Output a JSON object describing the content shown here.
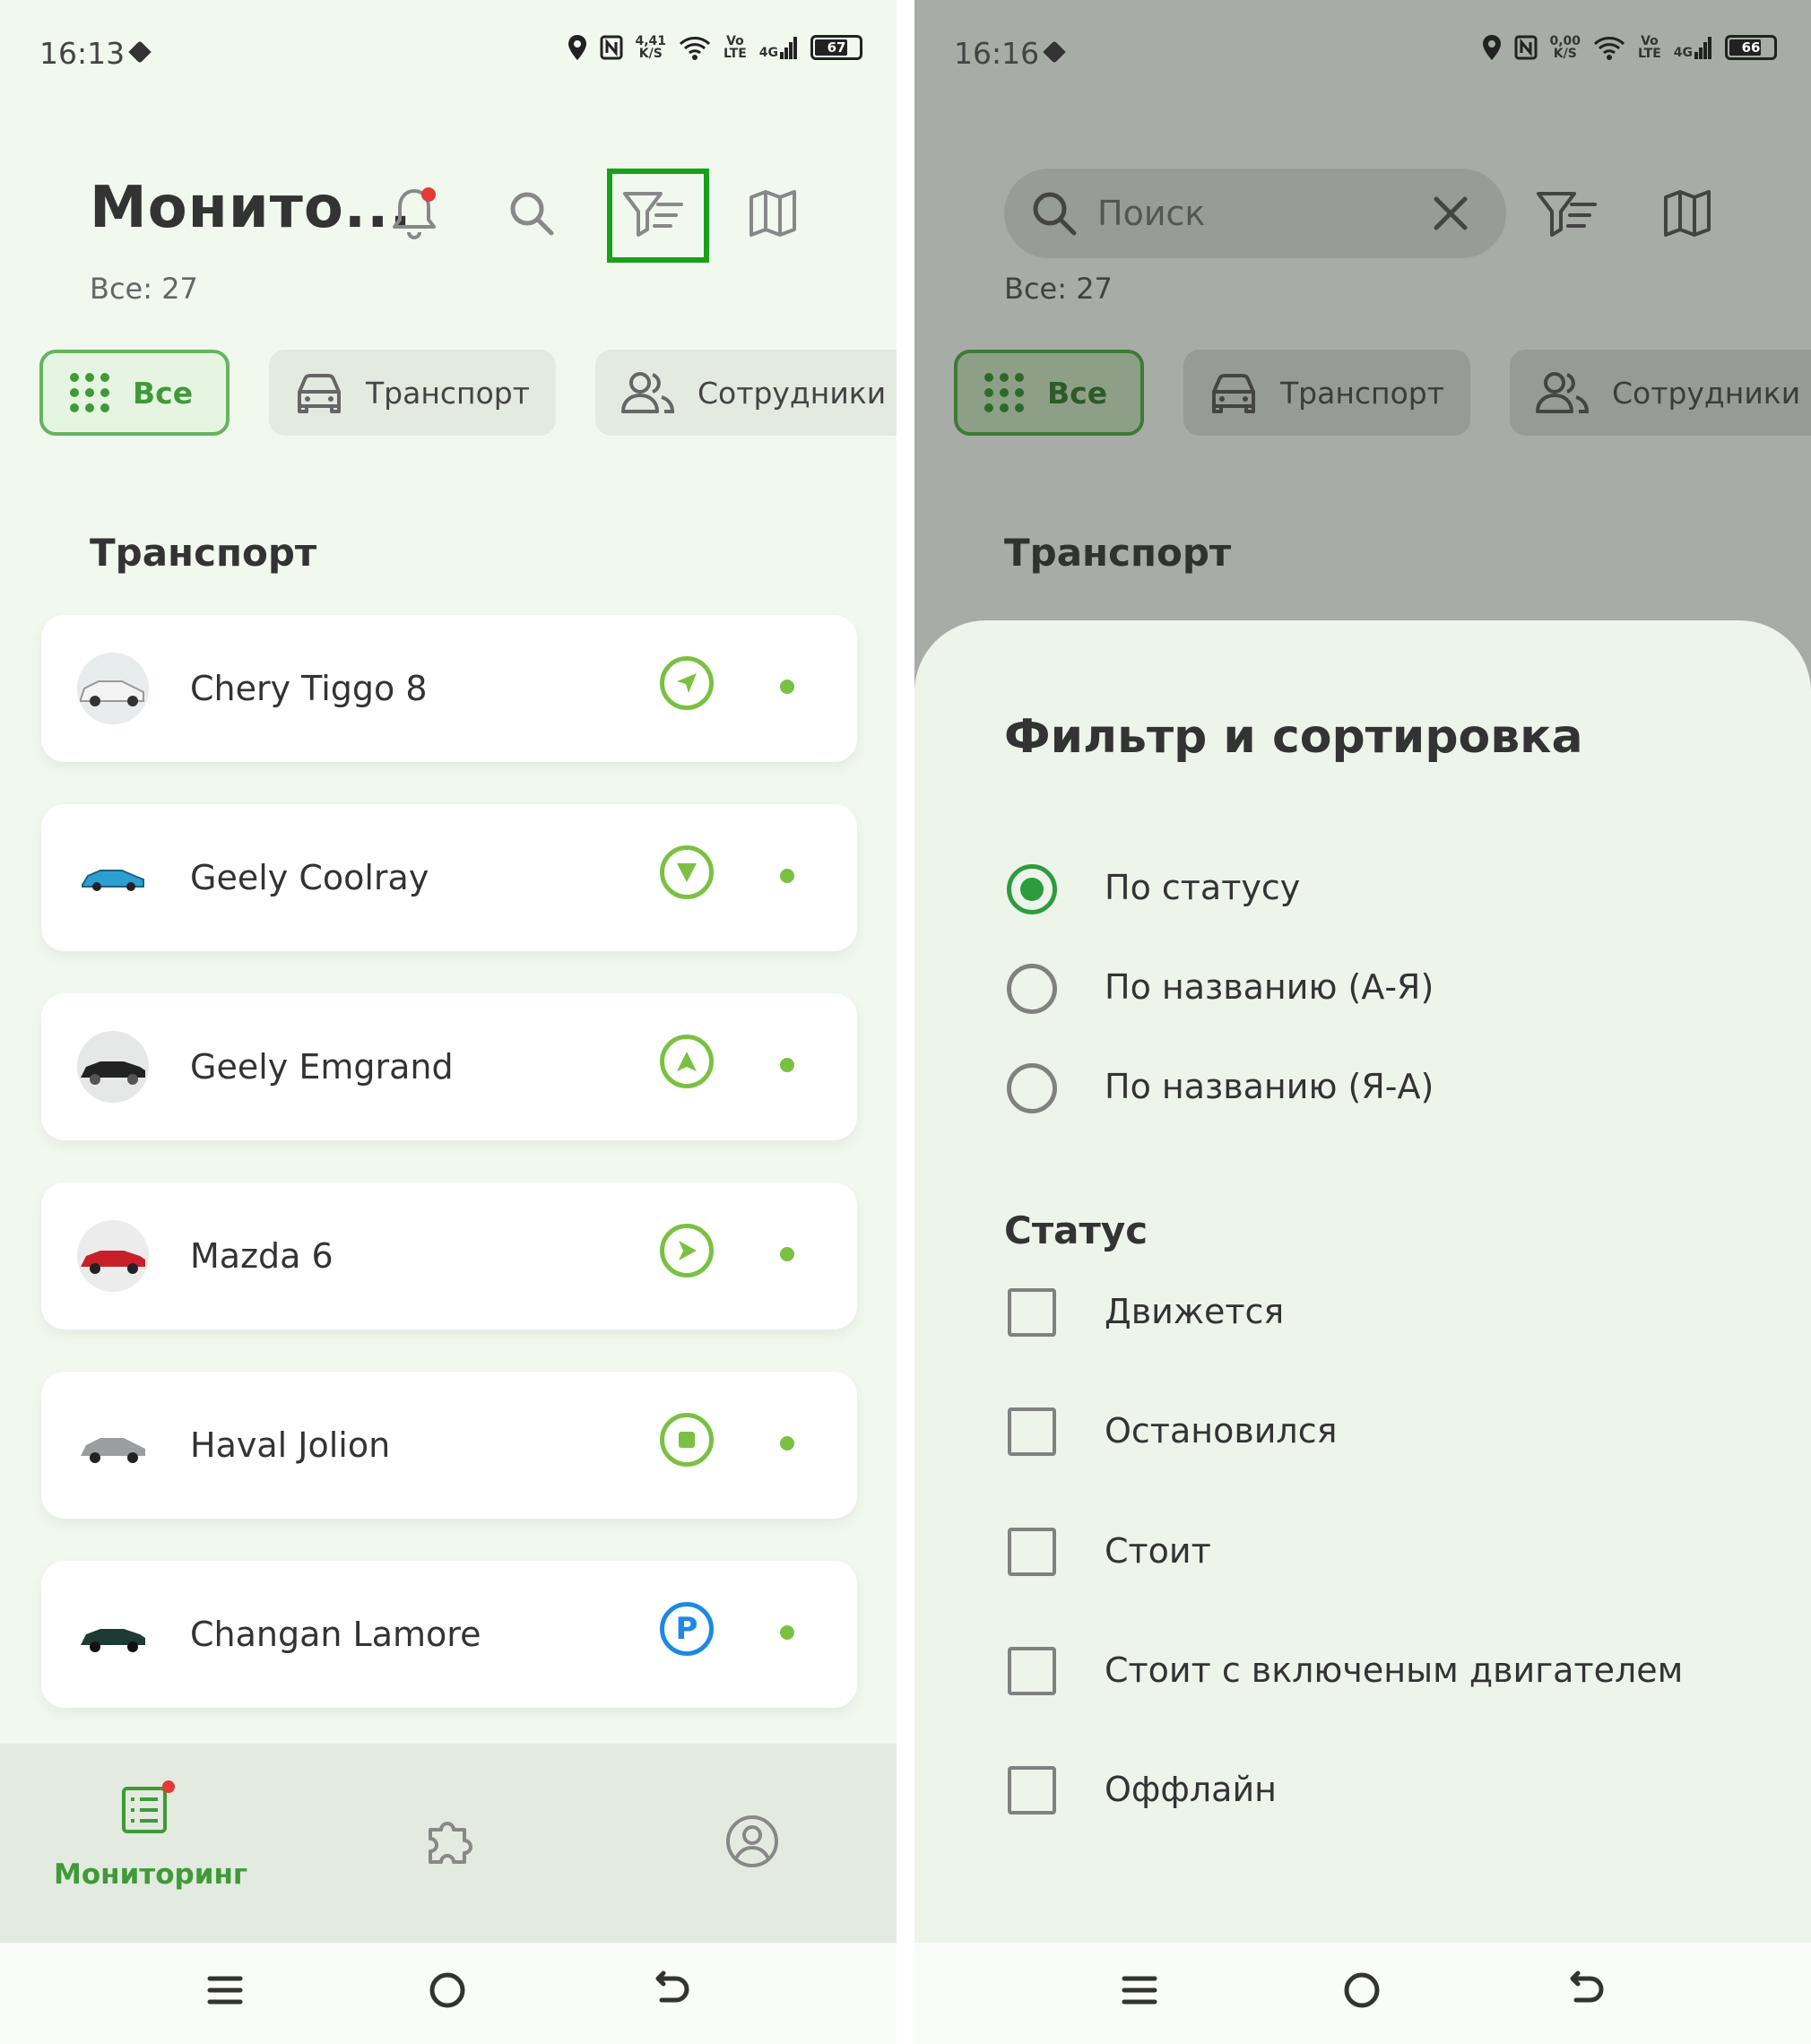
{
  "left": {
    "status": {
      "time": "16:13",
      "speed_top": "4,41",
      "speed_bottom": "K/S",
      "volte_top": "Vo",
      "volte_bottom": "LTE",
      "net": "4G",
      "battery": "67"
    },
    "header": {
      "title": "Монито...",
      "count": "Все: 27"
    },
    "chips": {
      "all": "Все",
      "transport": "Транспорт",
      "employees": "Сотрудники"
    },
    "section": "Транспорт",
    "vehicles": [
      {
        "name": "Chery Tiggo 8",
        "status": "moving"
      },
      {
        "name": "Geely Coolray",
        "status": "moving"
      },
      {
        "name": "Geely Emgrand",
        "status": "moving"
      },
      {
        "name": "Mazda 6",
        "status": "moving"
      },
      {
        "name": "Haval Jolion",
        "status": "stopped"
      },
      {
        "name": "Changan Lamore",
        "status": "parked"
      }
    ],
    "parking_letter": "P",
    "bottom_nav": {
      "monitoring": "Мониторинг"
    }
  },
  "right": {
    "status": {
      "time": "16:16",
      "speed_top": "0,00",
      "speed_bottom": "K/S",
      "volte_top": "Vo",
      "volte_bottom": "LTE",
      "net": "4G",
      "battery": "66"
    },
    "search": {
      "placeholder": "Поиск"
    },
    "header": {
      "count": "Все: 27"
    },
    "chips": {
      "all": "Все",
      "transport": "Транспорт",
      "employees": "Сотрудники"
    },
    "section": "Транспорт",
    "sheet": {
      "title": "Фильтр и сортировка",
      "sort_options": [
        "По статусу",
        "По названию (А-Я)",
        "По названию (Я-А)"
      ],
      "selected_sort": 0,
      "status_heading": "Статус",
      "status_options": [
        "Движется",
        "Остановился",
        "Стоит",
        "Стоит с включеным двигателем",
        "Оффлайн"
      ]
    }
  },
  "colors": {
    "accent": "#3f9a37",
    "moving": "#7ac142",
    "parked": "#1e88e5",
    "highlight": "#1aa11a",
    "notify": "#e53935"
  }
}
